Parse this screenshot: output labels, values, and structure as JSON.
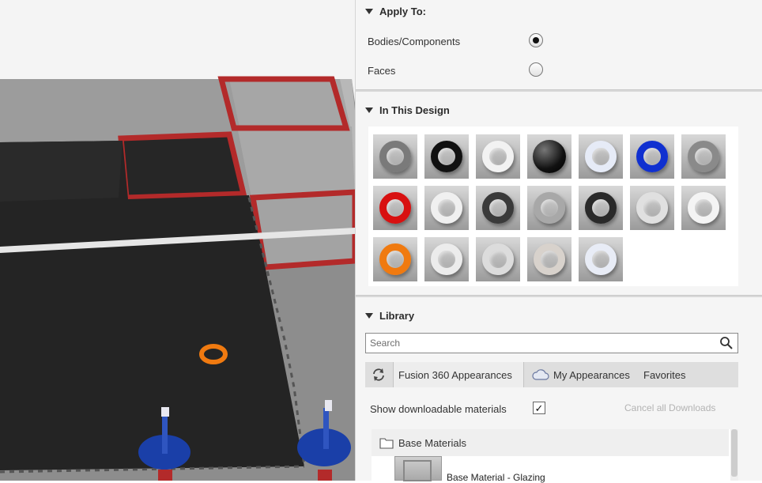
{
  "apply_to": {
    "header": "Apply To:",
    "options": [
      {
        "label": "Bodies/Components",
        "selected": true
      },
      {
        "label": "Faces",
        "selected": false
      }
    ]
  },
  "in_this_design": {
    "header": "In This Design",
    "swatches": [
      {
        "kind": "ring",
        "color": "#7a7a7a"
      },
      {
        "kind": "ring",
        "color": "#111111"
      },
      {
        "kind": "ring",
        "color": "#f2f2f2"
      },
      {
        "kind": "ball",
        "color": "#111111"
      },
      {
        "kind": "ring",
        "color": "#e6ebf7"
      },
      {
        "kind": "ring",
        "color": "#1030d0"
      },
      {
        "kind": "ring",
        "color": "#8a8a8a"
      },
      {
        "kind": "ring",
        "color": "#d81010"
      },
      {
        "kind": "ring",
        "color": "#f0f0f0"
      },
      {
        "kind": "ring",
        "color": "#3a3a3a"
      },
      {
        "kind": "ring",
        "color": "#a8a8a8"
      },
      {
        "kind": "ring",
        "color": "#2a2a2a"
      },
      {
        "kind": "ring",
        "color": "#e0e0e0"
      },
      {
        "kind": "ring",
        "color": "#f4f4f4"
      },
      {
        "kind": "ring",
        "color": "#f07a10"
      },
      {
        "kind": "ring",
        "color": "#ececec"
      },
      {
        "kind": "ring",
        "color": "#dcdcdc"
      },
      {
        "kind": "ring",
        "color": "#d8d2cc"
      },
      {
        "kind": "ring",
        "color": "#e8ecf6"
      }
    ]
  },
  "library": {
    "header": "Library",
    "search_placeholder": "Search",
    "tabs": {
      "refresh_icon": "refresh-icon",
      "fusion": "Fusion 360 Appearances",
      "cloud_icon": "cloud-icon",
      "my": "My Appearances",
      "favorites": "Favorites"
    },
    "show_downloadable_label": "Show downloadable materials",
    "show_downloadable_checked": true,
    "cancel_downloads": "Cancel all Downloads",
    "tree": {
      "folder_icon": "folder-icon",
      "folder_label": "Base Materials",
      "item_label": "Base Material - Glazing"
    }
  },
  "colors": {
    "accent_red": "#b32a2a",
    "mat_dark": "#242424",
    "marker_orange": "#f07a10",
    "marker_blue": "#1a3fa8"
  }
}
